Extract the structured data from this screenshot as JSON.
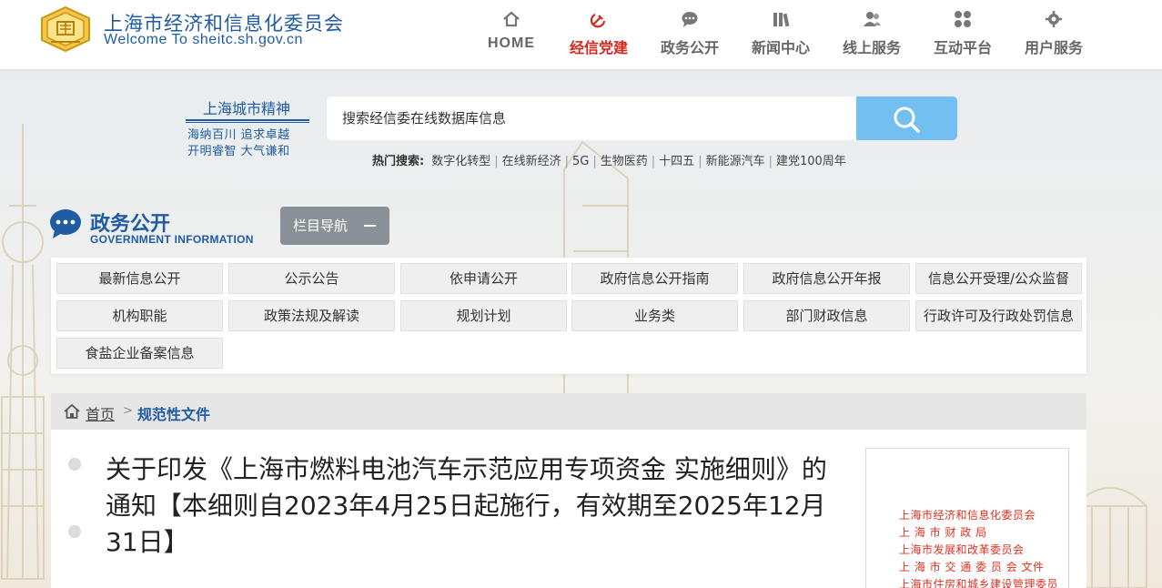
{
  "header": {
    "site_title": "上海市经济和信息化委员会",
    "site_subtitle": "Welcome To sheitc.sh.gov.cn",
    "nav": [
      {
        "label": "HOME",
        "icon": "home-icon"
      },
      {
        "label": "经信党建",
        "icon": "hammer-sickle-icon"
      },
      {
        "label": "政务公开",
        "icon": "chat-bubble-icon"
      },
      {
        "label": "新闻中心",
        "icon": "books-icon"
      },
      {
        "label": "线上服务",
        "icon": "users-icon"
      },
      {
        "label": "互动平台",
        "icon": "grid-dots-icon"
      },
      {
        "label": "用户服务",
        "icon": "gear-icon"
      }
    ],
    "active_color": "#d7261c"
  },
  "slogan": {
    "title": "上海城市精神",
    "line1": "海纳百川  追求卓越",
    "line2": "开明睿智  大气谦和"
  },
  "search": {
    "placeholder": "搜索经信委在线数据库信息",
    "hot_label": "热门搜索:",
    "hot_items": [
      "数字化转型",
      "在线新经济",
      "5G",
      "生物医药",
      "十四五",
      "新能源汽车",
      "建党100周年"
    ]
  },
  "section": {
    "title": "政务公开",
    "subtitle": "GOVERNMENT INFORMATION",
    "nav_button": "栏目导航"
  },
  "grid": [
    [
      "最新信息公开",
      "公示公告",
      "依申请公开",
      "政府信息公开指南",
      "政府信息公开年报",
      "信息公开受理/公众监督"
    ],
    [
      "机构职能",
      "政策法规及解读",
      "规划计划",
      "业务类",
      "部门财政信息",
      "行政许可及行政处罚信息"
    ],
    [
      "食盐企业备案信息"
    ]
  ],
  "breadcrumb": {
    "home": "首页",
    "separator": ">",
    "current": "规范性文件"
  },
  "article": {
    "title": "关于印发《上海市燃料电池汽车示范应用专项资金 实施细则》的通知【本细则自2023年4月25日起施行，有效期至2025年12月31日】"
  },
  "doc_header": [
    "上海市经济和信息化委员会",
    "上  海  市  财  政  局",
    "上海市发展和改革委员会",
    "上  海  市  交  通  委  员  会   文件",
    "上海市住房和城乡建设管理委员"
  ],
  "colors": {
    "brand_blue": "#1f5ca3",
    "search_button": "#73bff1",
    "doc_red": "#e03020"
  }
}
